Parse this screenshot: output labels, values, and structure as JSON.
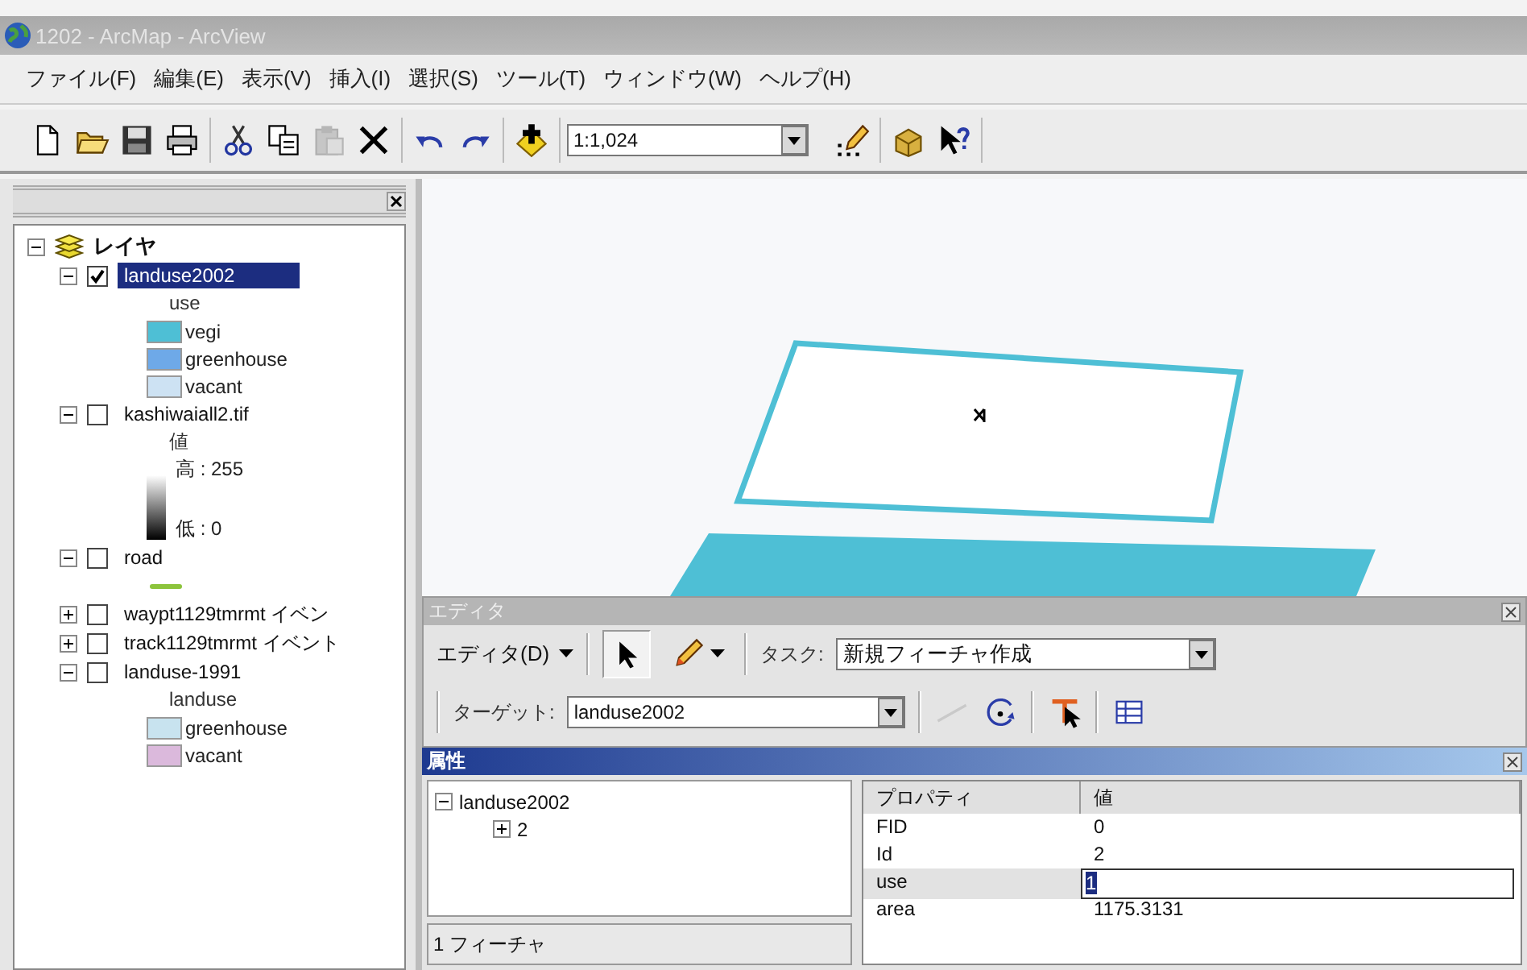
{
  "window": {
    "title": "1202 - ArcMap - ArcView"
  },
  "menu": [
    "ファイル(F)",
    "編集(E)",
    "表示(V)",
    "挿入(I)",
    "選択(S)",
    "ツール(T)",
    "ウィンドウ(W)",
    "ヘルプ(H)"
  ],
  "toolbar": {
    "groups_before": [
      [
        {
          "kind": "new",
          "disabled": false
        },
        {
          "kind": "open",
          "disabled": false
        },
        {
          "kind": "save",
          "disabled": false
        },
        {
          "kind": "print",
          "disabled": false
        }
      ],
      [
        {
          "kind": "cut",
          "disabled": false
        },
        {
          "kind": "copy",
          "disabled": false
        },
        {
          "kind": "paste",
          "disabled": true
        },
        {
          "kind": "delete",
          "disabled": false
        }
      ],
      [
        {
          "kind": "undo",
          "disabled": false
        },
        {
          "kind": "redo",
          "disabled": false
        }
      ],
      [
        {
          "kind": "add",
          "disabled": false
        }
      ]
    ],
    "scale": "1:1,024",
    "groups_after": [
      [
        {
          "kind": "editor",
          "disabled": false
        }
      ],
      [
        {
          "kind": "catalog",
          "disabled": false
        },
        {
          "kind": "help",
          "disabled": false
        }
      ]
    ]
  },
  "toc": {
    "label": "レイヤ",
    "expanded": true,
    "children": [
      {
        "kind": "classes",
        "name": "landuse2002",
        "expanded": true,
        "checked": true,
        "selected": true,
        "heading": "use",
        "legend": [
          {
            "label": "vegi",
            "color": "#4ebfd5"
          },
          {
            "label": "greenhouse",
            "color": "#6ea9e8"
          },
          {
            "label": "vacant",
            "color": "#cde2f3"
          }
        ]
      },
      {
        "kind": "ramp",
        "name": "kashiwaiall2.tif",
        "expanded": true,
        "checked": false,
        "selected": false,
        "heading": "値",
        "high": "高 : 255",
        "low": "低 : 0"
      },
      {
        "kind": "line",
        "name": "road",
        "expanded": true,
        "checked": false,
        "selected": false,
        "color": "#8cc43c"
      },
      {
        "name": "waypt1129tmrmt イベン",
        "expanded": false,
        "checked": false,
        "selected": false
      },
      {
        "name": "track1129tmrmt イベント",
        "expanded": false,
        "checked": false,
        "selected": false
      },
      {
        "kind": "classes",
        "name": "landuse-1991",
        "expanded": true,
        "checked": false,
        "selected": false,
        "heading": "landuse",
        "legend": [
          {
            "label": "greenhouse",
            "color": "#c8e3ef"
          },
          {
            "label": "vacant",
            "color": "#dbb9dc"
          }
        ]
      }
    ]
  },
  "editor": {
    "title": "エディタ",
    "menu": "エディタ(D)",
    "tools": [
      {
        "kind": "arrow",
        "pressed": true
      },
      {
        "kind": "pencil",
        "pressed": false
      }
    ],
    "task_label": "タスク:",
    "task": "新規フィーチャ作成",
    "target_label": "ターゲット:",
    "target": "landuse2002",
    "tools2": [
      {
        "kind": "line",
        "disabled": true
      },
      {
        "kind": "rotate",
        "disabled": false
      },
      {
        "kind": "split",
        "disabled": false
      },
      {
        "kind": "table",
        "disabled": false
      }
    ]
  },
  "attributes": {
    "title": "属性",
    "tree": {
      "label": "landuse2002",
      "expanded": true,
      "children": [
        {
          "label": "2",
          "expanded": false
        }
      ]
    },
    "count": "1 フィーチャ",
    "columns": [
      "プロパティ",
      "値"
    ],
    "rows": [
      {
        "property": "FID",
        "value": "0",
        "selected": false
      },
      {
        "property": "Id",
        "value": "2",
        "selected": false
      },
      {
        "property": "use",
        "value": "1",
        "selected": true
      },
      {
        "property": "area",
        "value": "1175.3131",
        "selected": false
      }
    ]
  }
}
